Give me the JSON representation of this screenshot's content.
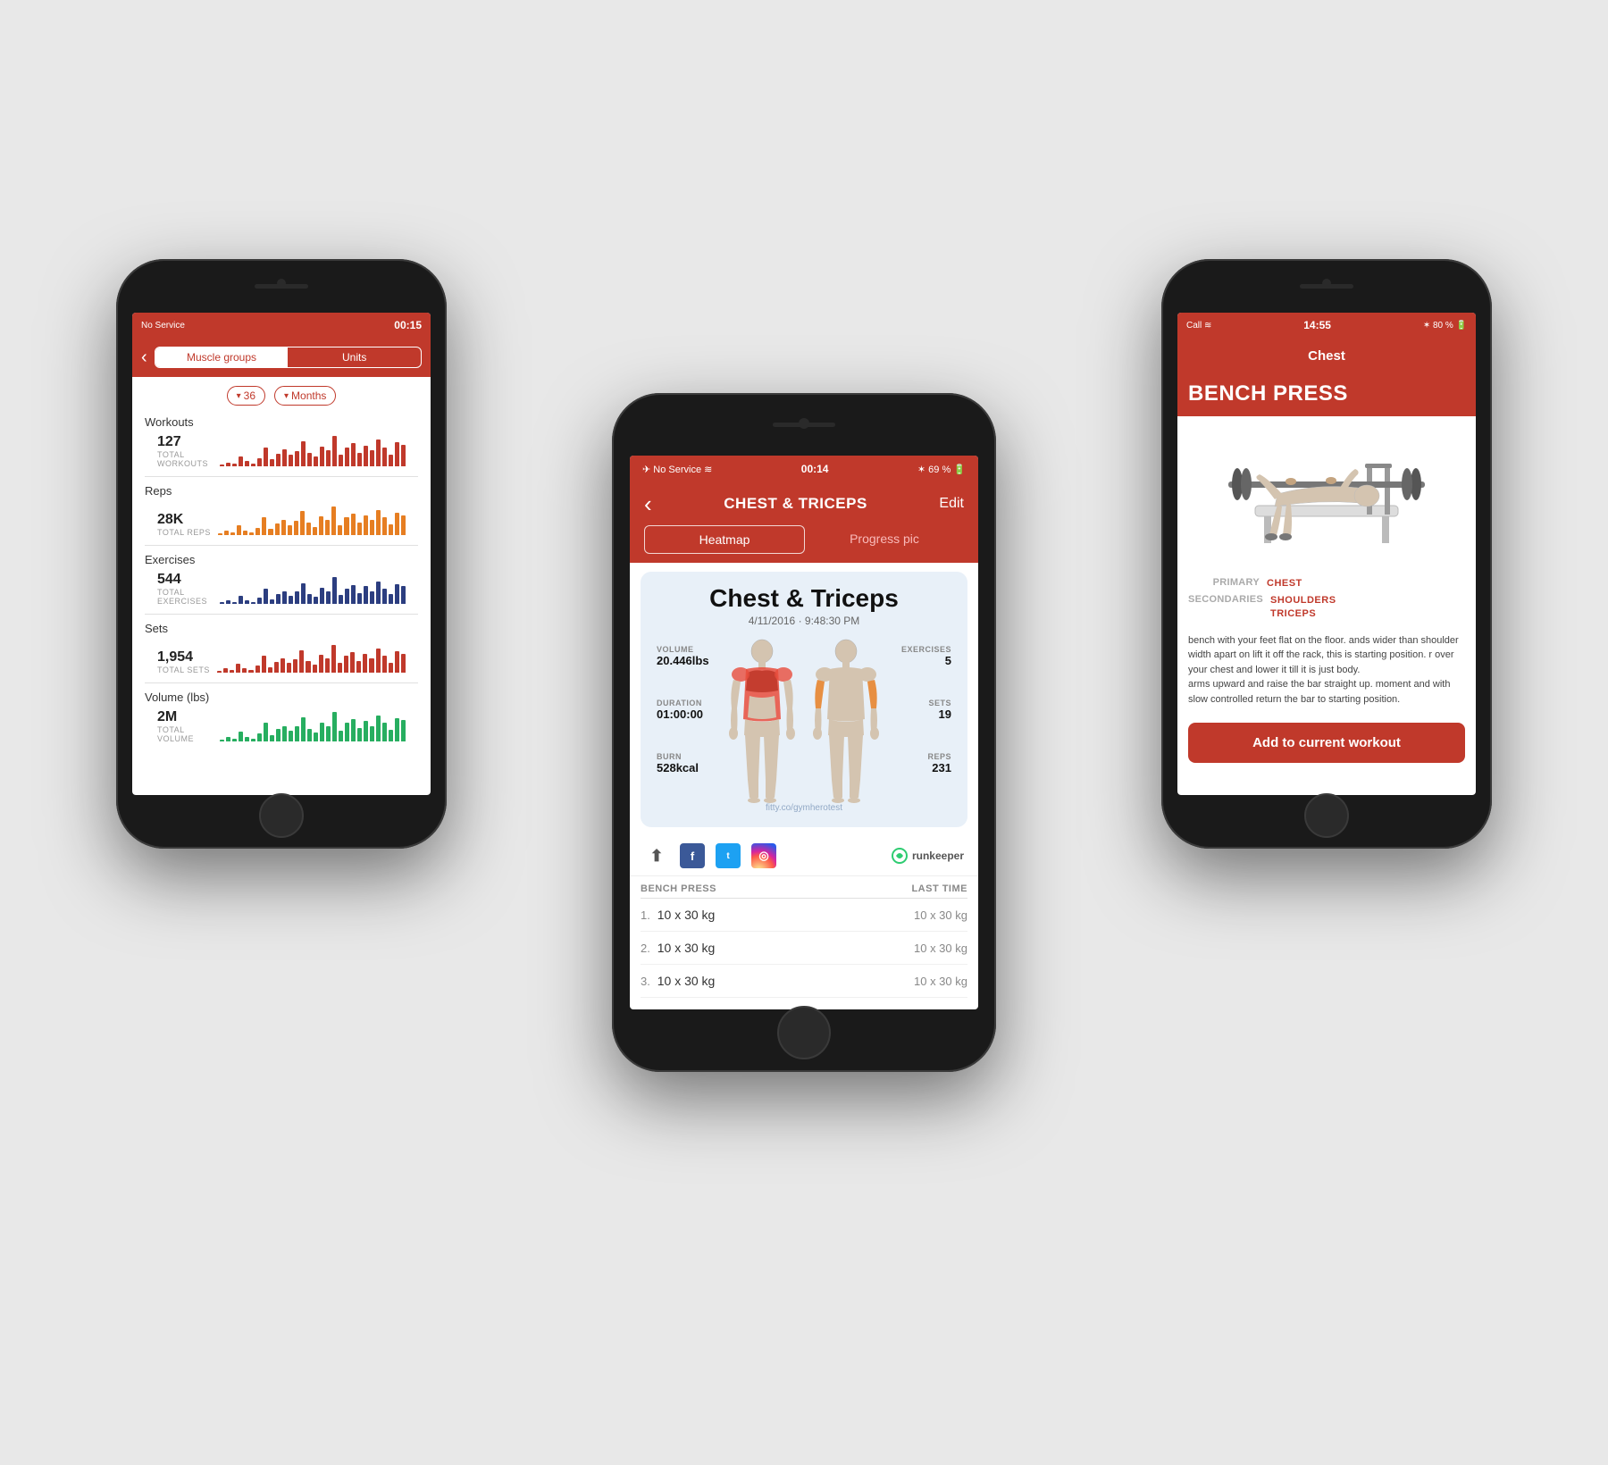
{
  "phones": {
    "left": {
      "statusBar": {
        "service": "No Service",
        "wifi": "wifi",
        "time": "00:15"
      },
      "nav": {
        "backLabel": "‹",
        "tabs": [
          "Muscle groups",
          "Units"
        ],
        "activeTab": "Muscle groups"
      },
      "filters": {
        "number": "36",
        "period": "Months"
      },
      "stats": [
        {
          "label": "Workouts",
          "value": "127",
          "subLabel": "TOTAL WORKOUTS",
          "color": "#c0392b",
          "bars": [
            2,
            4,
            3,
            8,
            5,
            3,
            7,
            12,
            6,
            9,
            11,
            8,
            10,
            14,
            9,
            7,
            12,
            10,
            15,
            8,
            11,
            13,
            9,
            12,
            10,
            14,
            11,
            8,
            13,
            12
          ]
        },
        {
          "label": "Reps",
          "value": "28K",
          "subLabel": "TOTAL REPS",
          "color": "#e67e22",
          "bars": [
            2,
            5,
            3,
            7,
            4,
            3,
            6,
            10,
            5,
            8,
            9,
            7,
            9,
            12,
            8,
            6,
            10,
            9,
            13,
            7,
            10,
            11,
            8,
            10,
            9,
            12,
            10,
            7,
            11,
            10
          ]
        },
        {
          "label": "Exercises",
          "value": "544",
          "subLabel": "TOTAL EXERCISES",
          "color": "#2c3e80",
          "bars": [
            1,
            3,
            2,
            5,
            3,
            2,
            4,
            7,
            4,
            6,
            7,
            5,
            7,
            9,
            6,
            5,
            8,
            7,
            10,
            5,
            8,
            9,
            6,
            8,
            7,
            10,
            8,
            5,
            9,
            8
          ]
        },
        {
          "label": "Sets",
          "value": "1,954",
          "subLabel": "TOTAL SETS",
          "color": "#c0392b",
          "bars": [
            2,
            4,
            3,
            6,
            4,
            3,
            5,
            9,
            5,
            7,
            8,
            6,
            8,
            11,
            7,
            6,
            9,
            8,
            12,
            6,
            9,
            10,
            7,
            9,
            8,
            11,
            9,
            6,
            10,
            9
          ]
        },
        {
          "label": "Volume (lbs)",
          "value": "2M",
          "subLabel": "TOTAL VOLUME",
          "color": "#27ae60",
          "bars": [
            2,
            4,
            3,
            7,
            4,
            3,
            6,
            10,
            5,
            8,
            9,
            7,
            9,
            13,
            8,
            6,
            10,
            9,
            14,
            7,
            10,
            12,
            8,
            11,
            9,
            13,
            10,
            7,
            12,
            11
          ]
        }
      ]
    },
    "center": {
      "statusBar": {
        "service": "No Service",
        "wifi": "wifi",
        "time": "00:14",
        "bluetooth": "BT",
        "battery": "69 %"
      },
      "nav": {
        "backLabel": "‹",
        "title": "CHEST & TRICEPS",
        "editLabel": "Edit"
      },
      "tabs": [
        "Heatmap",
        "Progress pic"
      ],
      "activeTab": "Heatmap",
      "workout": {
        "title": "Chest & Triceps",
        "date": "4/11/2016 · 9:48:30 PM",
        "stats": {
          "volume": "20.446lbs",
          "exercises": "5",
          "duration": "01:00:00",
          "sets": "19",
          "burn": "528kcal",
          "reps": "231"
        },
        "watermark": "fitty.co/gymherotest"
      },
      "social": {
        "shareIcon": "⬆",
        "facebook": "f",
        "twitter": "t",
        "instagram": "📷",
        "runkeeper": "runkeeper"
      },
      "exerciseTable": {
        "header": "BENCH PRESS",
        "lastTimeLabel": "LAST TIME",
        "rows": [
          {
            "num": "1.",
            "value": "10 x 30 kg",
            "lastTime": "10 x 30 kg"
          },
          {
            "num": "2.",
            "value": "10 x 30 kg",
            "lastTime": "10 x 30 kg"
          },
          {
            "num": "3.",
            "value": "10 x 30 kg",
            "lastTime": "10 x 30 kg"
          }
        ]
      }
    },
    "right": {
      "statusBar": {
        "service": "Call",
        "wifi": "wifi",
        "time": "14:55",
        "bluetooth": "BT",
        "battery": "80 %"
      },
      "nav": {
        "title": "Chest"
      },
      "exercise": {
        "name": "BENCH PRESS",
        "primary": "CHEST",
        "secondaries": "SHOULDERS\nTRICEPS",
        "description": "bench with your feet flat on the floor. ands wider than shoulder width apart on lift it off the rack, this is starting position. r over your chest and lower it till it is just body.\narms upward and raise the bar straight up. moment and with slow controlled return the bar to starting position.",
        "addButton": "Add to current workout"
      }
    }
  }
}
